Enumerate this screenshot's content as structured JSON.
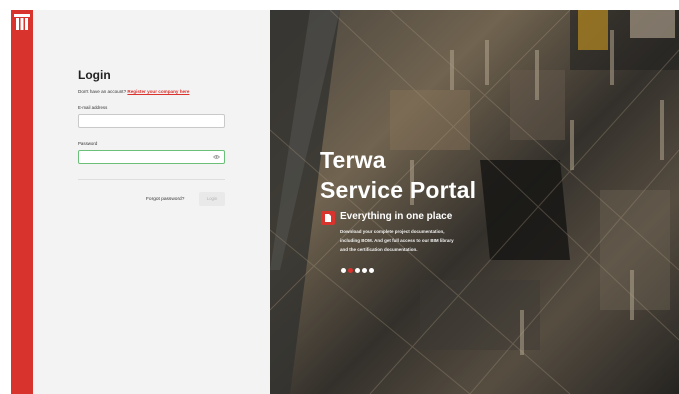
{
  "brand": {
    "logo_icon": "terwa-logo-icon",
    "accent": "#d9332e"
  },
  "login": {
    "title": "Login",
    "no_account_text": "Don't have an account? ",
    "register_link": "Register your company here",
    "email_label": "E-mail address",
    "email_value": "",
    "password_label": "Password",
    "password_value": "",
    "show_password_icon": "eye-icon",
    "forgot_password": "Forgot password?",
    "login_button": "Login"
  },
  "hero": {
    "title_line1": "Terwa",
    "title_line2": "Service Portal",
    "feature_icon": "document-icon",
    "feature_title": "Everything in one place",
    "feature_description": "Download your complete project documentation, including BOM. And get full access to our BIM library and the certification documentation.",
    "carousel": {
      "count": 5,
      "active_index": 1
    }
  }
}
